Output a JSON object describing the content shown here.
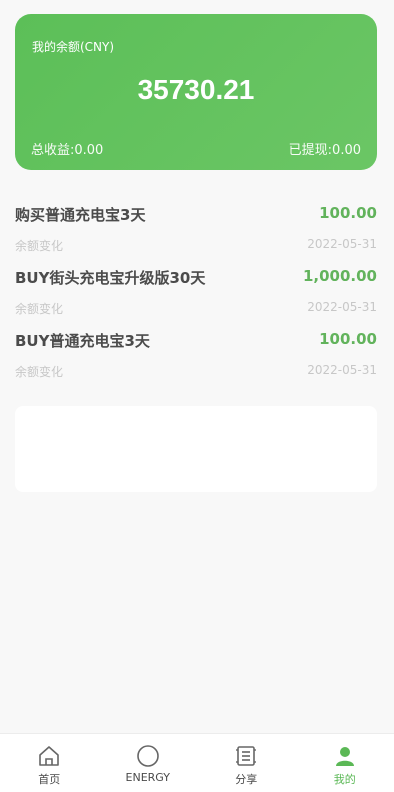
{
  "balance": {
    "label": "我的余额(CNY)",
    "amount": "35730.21",
    "total_earnings": "总收益:0.00",
    "withdrawn": "已提现:0.00"
  },
  "records": [
    {
      "title": "购买普通充电宝3天",
      "amount": "100.00",
      "type": "余额变化",
      "date": "2022-05-31"
    },
    {
      "title": "BUY街头充电宝升级版30天",
      "amount": "1,000.00",
      "type": "余额变化",
      "date": "2022-05-31"
    },
    {
      "title": "BUY普通充电宝3天",
      "amount": "100.00",
      "type": "余额变化",
      "date": "2022-05-31"
    }
  ],
  "tabbar": [
    {
      "label": "首页",
      "icon": "home-icon"
    },
    {
      "label": "ENERGY",
      "icon": "circle-icon"
    },
    {
      "label": "分享",
      "icon": "share-icon"
    },
    {
      "label": "我的",
      "icon": "user-icon",
      "active": true
    }
  ],
  "colors": {
    "accent": "#5cbf58",
    "amount": "#62b35c"
  }
}
